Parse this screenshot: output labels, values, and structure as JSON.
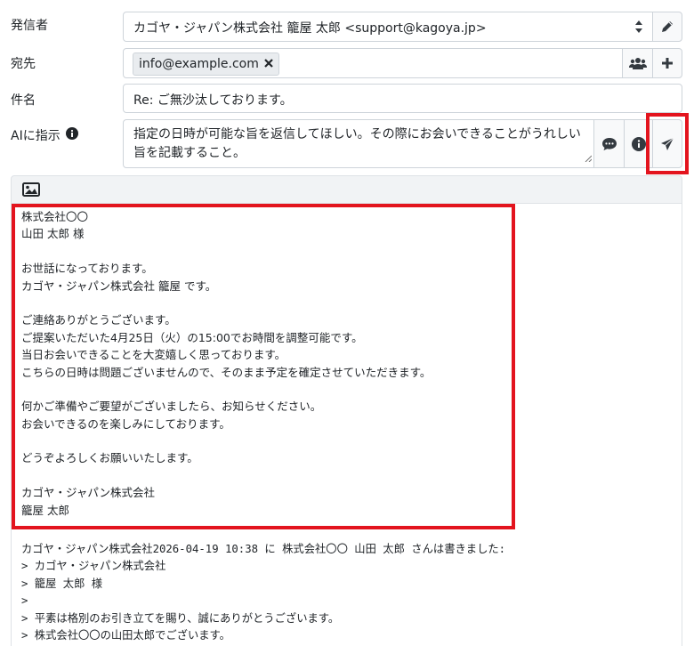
{
  "sender": {
    "label": "発信者",
    "value": "カゴヤ・ジャパン株式会社 籠屋 太郎 <support@kagoya.jp>"
  },
  "to": {
    "label": "宛先",
    "chip": "info@example.com"
  },
  "subject": {
    "label": "件名",
    "value": "Re: ご無沙汰しております。"
  },
  "ai": {
    "label": "AIに指示",
    "instruction": "指定の日時が可能な旨を返信してほしい。その際にお会いできることがうれしい旨を記載すること。"
  },
  "reply_lines": [
    "株式会社〇〇",
    "山田 太郎 様",
    "",
    "お世話になっております。",
    "カゴヤ・ジャパン株式会社 籠屋 です。",
    "",
    "ご連絡ありがとうございます。",
    "ご提案いただいた4月25日（火）の15:00でお時間を調整可能です。",
    "当日お会いできることを大変嬉しく思っております。",
    "こちらの日時は問題ございませんので、そのまま予定を確定させていただきます。",
    "",
    "何かご準備やご要望がございましたら、お知らせください。",
    "お会いできるのを楽しみにしております。",
    "",
    "どうぞよろしくお願いいたします。",
    "",
    "カゴヤ・ジャパン株式会社",
    "籠屋 太郎"
  ],
  "quote_lines": [
    "カゴヤ・ジャパン株式会社2026-04-19 10:38 に 株式会社〇〇 山田 太郎 さんは書きました:",
    "> カゴヤ・ジャパン株式会社",
    "> 籠屋 太郎 様",
    ">",
    "> 平素は格別のお引き立てを賜り、誠にありがとうございます。",
    "> 株式会社〇〇の山田太郎でございます。"
  ]
}
